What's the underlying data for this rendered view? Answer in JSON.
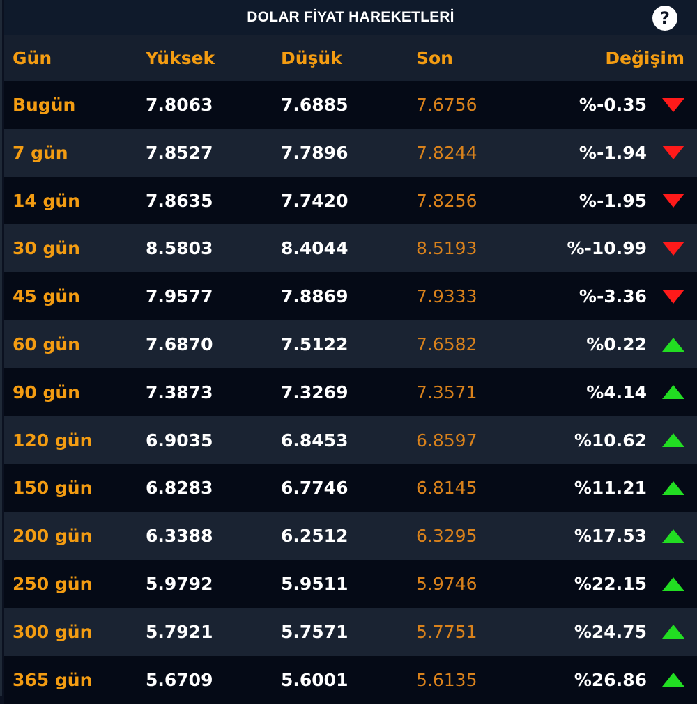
{
  "title": "DOLAR FİYAT HAREKETLERİ",
  "help_icon": "?",
  "headers": {
    "gun": "Gün",
    "yuksek": "Yüksek",
    "dusuk": "Düşük",
    "son": "Son",
    "degisim": "Değişim"
  },
  "colors": {
    "accent_orange": "#f39c12",
    "down_red": "#ff1a1a",
    "up_green": "#22dd22"
  },
  "rows": [
    {
      "gun": "Bugün",
      "yuksek": "7.8063",
      "dusuk": "7.6885",
      "son": "7.6756",
      "degisim": "%-0.35",
      "direction": "down"
    },
    {
      "gun": "7 gün",
      "yuksek": "7.8527",
      "dusuk": "7.7896",
      "son": "7.8244",
      "degisim": "%-1.94",
      "direction": "down"
    },
    {
      "gun": "14 gün",
      "yuksek": "7.8635",
      "dusuk": "7.7420",
      "son": "7.8256",
      "degisim": "%-1.95",
      "direction": "down"
    },
    {
      "gun": "30 gün",
      "yuksek": "8.5803",
      "dusuk": "8.4044",
      "son": "8.5193",
      "degisim": "%-10.99",
      "direction": "down"
    },
    {
      "gun": "45 gün",
      "yuksek": "7.9577",
      "dusuk": "7.8869",
      "son": "7.9333",
      "degisim": "%-3.36",
      "direction": "down"
    },
    {
      "gun": "60 gün",
      "yuksek": "7.6870",
      "dusuk": "7.5122",
      "son": "7.6582",
      "degisim": "%0.22",
      "direction": "up"
    },
    {
      "gun": "90 gün",
      "yuksek": "7.3873",
      "dusuk": "7.3269",
      "son": "7.3571",
      "degisim": "%4.14",
      "direction": "up"
    },
    {
      "gun": "120 gün",
      "yuksek": "6.9035",
      "dusuk": "6.8453",
      "son": "6.8597",
      "degisim": "%10.62",
      "direction": "up"
    },
    {
      "gun": "150 gün",
      "yuksek": "6.8283",
      "dusuk": "6.7746",
      "son": "6.8145",
      "degisim": "%11.21",
      "direction": "up"
    },
    {
      "gun": "200 gün",
      "yuksek": "6.3388",
      "dusuk": "6.2512",
      "son": "6.3295",
      "degisim": "%17.53",
      "direction": "up"
    },
    {
      "gun": "250 gün",
      "yuksek": "5.9792",
      "dusuk": "5.9511",
      "son": "5.9746",
      "degisim": "%22.15",
      "direction": "up"
    },
    {
      "gun": "300 gün",
      "yuksek": "5.7921",
      "dusuk": "5.7571",
      "son": "5.7751",
      "degisim": "%24.75",
      "direction": "up"
    },
    {
      "gun": "365 gün",
      "yuksek": "5.6709",
      "dusuk": "5.6001",
      "son": "5.6135",
      "degisim": "%26.86",
      "direction": "up"
    }
  ]
}
